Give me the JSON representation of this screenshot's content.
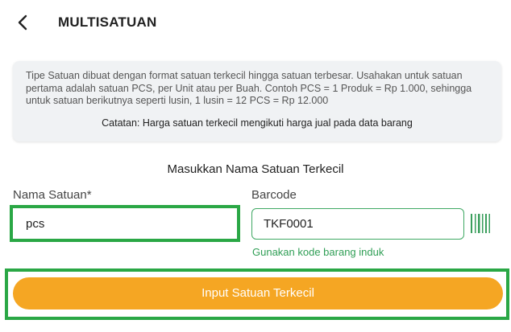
{
  "header": {
    "title": "MULTISATUAN",
    "back_icon": "chevron-left-icon"
  },
  "info": {
    "text": "Tipe Satuan dibuat dengan format satuan terkecil hingga satuan terbesar. Usahakan untuk satuan pertama adalah satuan PCS, per Unit atau per Buah. Contoh PCS = 1 Produk = Rp 1.000, sehingga untuk satuan berikutnya seperti lusin, 1 lusin = 12 PCS = Rp 12.000",
    "note": "Catatan: Harga satuan terkecil mengikuti harga jual pada data barang"
  },
  "form": {
    "section_title": "Masukkan Nama Satuan Terkecil",
    "nama_label": "Nama Satuan*",
    "nama_value": "pcs",
    "barcode_label": "Barcode",
    "barcode_value": "TKF0001",
    "barcode_icon": "barcode-scan-icon",
    "barcode_hint": "Gunakan kode barang induk",
    "submit_label": "Input Satuan Terkecil"
  },
  "colors": {
    "accent_green": "#2f9e55",
    "highlight_green": "#2aa745",
    "button_orange": "#f5a623",
    "card_bg": "#f0f2f4"
  }
}
